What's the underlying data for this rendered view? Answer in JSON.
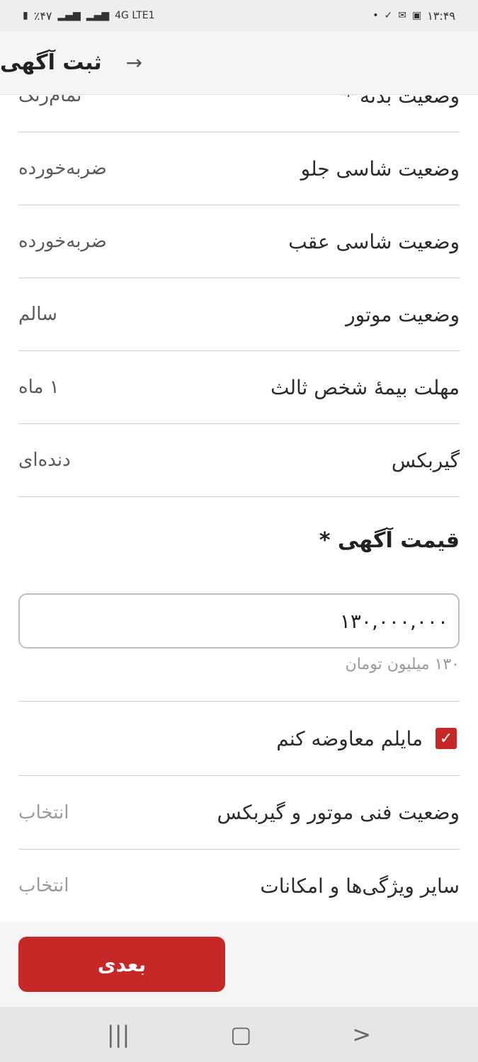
{
  "status_bar": {
    "battery": "٪۴۷",
    "network": "4G LTE1",
    "time": "۱۳:۴۹"
  },
  "app_bar": {
    "title": "ثبت آگهی",
    "back_icon": "arrow-right-icon"
  },
  "rows": [
    {
      "label": "وضعیت بدنه *",
      "value": "تمام‌رنگ"
    },
    {
      "label": "وضعیت شاسی جلو",
      "value": "ضربه‌خورده"
    },
    {
      "label": "وضعیت شاسی عقب",
      "value": "ضربه‌خورده"
    },
    {
      "label": "وضعیت موتور",
      "value": "سالم"
    },
    {
      "label": "مهلت بیمهٔ شخص ثالث",
      "value": "۱ ماه"
    },
    {
      "label": "گیربکس",
      "value": "دنده‌ای"
    }
  ],
  "price": {
    "title": "قیمت آگهی *",
    "value": "۱۳۰,۰۰۰,۰۰۰",
    "hint": "۱۳۰ میلیون تومان"
  },
  "exchange": {
    "label": "مایلم معاوضه کنم",
    "checked": true
  },
  "select_rows": [
    {
      "label": "وضعیت فنی موتور و گیربکس",
      "value": "انتخاب"
    },
    {
      "label": "سایر ویژگی‌ها و امکانات",
      "value": "انتخاب"
    }
  ],
  "footer": {
    "next_label": "بعدی"
  },
  "colors": {
    "accent": "#c62828",
    "divider": "#cfcfcf"
  }
}
